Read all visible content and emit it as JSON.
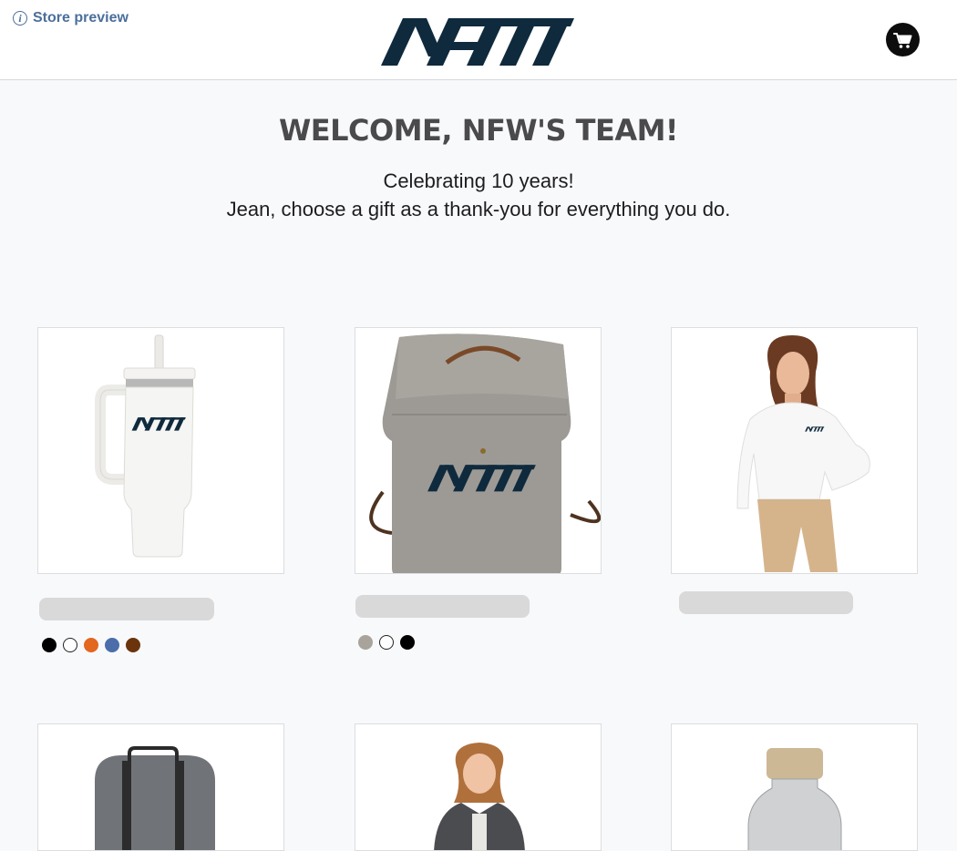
{
  "header": {
    "preview_label": "Store preview",
    "preview_icon": "info-icon",
    "cart_icon": "cart-icon"
  },
  "hero": {
    "title": "WELCOME, NFW'S TEAM!",
    "line1": "Celebrating 10 years!",
    "line2": "Jean, choose a gift as a thank-you for everything you do."
  },
  "colors": {
    "brand_navy": "#0f2a3d",
    "link_blue": "#4b6f9a",
    "skeleton": "#d9d9da"
  },
  "products": [
    {
      "kind": "tumbler",
      "swatches": [
        "#000000",
        "#ffffff",
        "#e2671f",
        "#4b6eaa",
        "#6b340d"
      ]
    },
    {
      "kind": "canvas-backpack",
      "swatches": [
        "#a8a39b",
        "#ffffff",
        "#000000"
      ]
    },
    {
      "kind": "dress-shirt",
      "swatches": []
    },
    {
      "kind": "heather-backpack",
      "swatches": []
    },
    {
      "kind": "jacket",
      "swatches": []
    },
    {
      "kind": "glass-bottle",
      "swatches": []
    }
  ]
}
